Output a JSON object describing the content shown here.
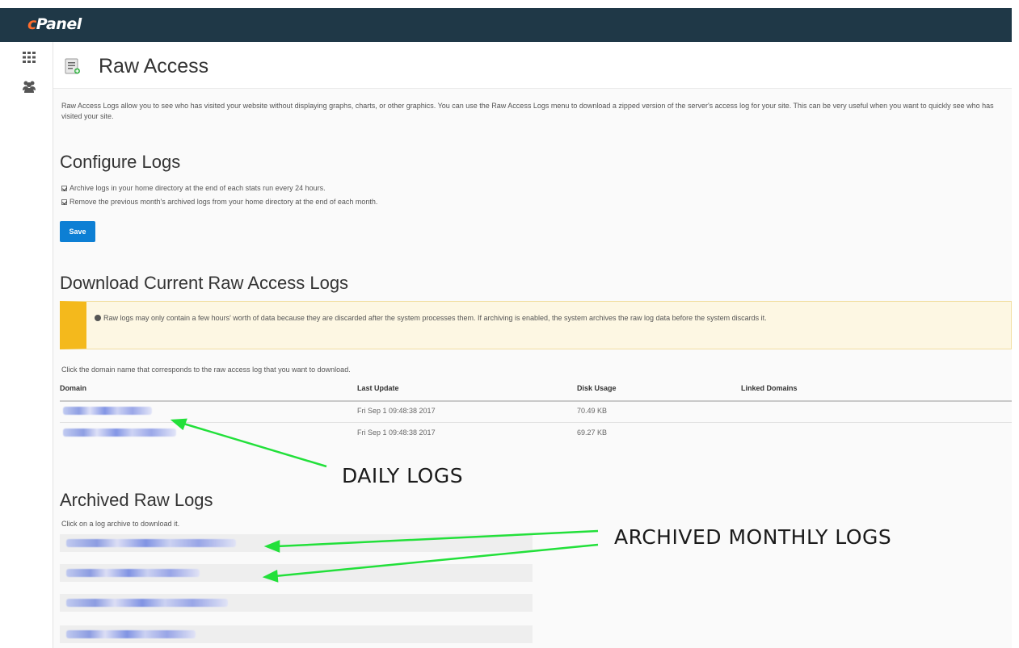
{
  "app": {
    "logo_prefix": "c",
    "logo_rest": "Panel"
  },
  "sidebar": {
    "items": [
      {
        "icon": "grid-icon"
      },
      {
        "icon": "users-icon"
      }
    ]
  },
  "page": {
    "title": "Raw Access",
    "intro": "Raw Access Logs allow you to see who has visited your website without displaying graphs, charts, or other graphics. You can use the Raw Access Logs menu to download a zipped version of the server's access log for your site. This can be very useful when you want to quickly see who has visited your site."
  },
  "configure": {
    "heading": "Configure Logs",
    "option1": "Archive logs in your home directory at the end of each stats run every 24 hours.",
    "option2": "Remove the previous month's archived logs from your home directory at the end of each month.",
    "save_label": "Save"
  },
  "download": {
    "heading": "Download Current Raw Access Logs",
    "notice": "Raw logs may only contain a few hours' worth of data because they are discarded after the system processes them. If archiving is enabled, the system archives the raw log data before the system discards it.",
    "instruction": "Click the domain name that corresponds to the raw access log that you want to download.",
    "columns": [
      "Domain",
      "Last Update",
      "Disk Usage",
      "Linked Domains"
    ],
    "rows": [
      {
        "last_update": "Fri Sep 1 09:48:38 2017",
        "disk_usage": "70.49 KB",
        "linked": ""
      },
      {
        "last_update": "Fri Sep 1 09:48:38 2017",
        "disk_usage": "69.27 KB",
        "linked": ""
      }
    ]
  },
  "archived": {
    "heading": "Archived Raw Logs",
    "instruction": "Click on a log archive to download it.",
    "archive_count": 4
  },
  "annotations": {
    "daily": "DAILY LOGS",
    "monthly": "ARCHIVED MONTHLY LOGS",
    "arrow_color": "#22e03a"
  },
  "colors": {
    "topbar": "#1f3847",
    "save_button": "#0d7fd4",
    "notice_bar": "#f4b91c",
    "notice_bg": "#fdf7e3"
  }
}
